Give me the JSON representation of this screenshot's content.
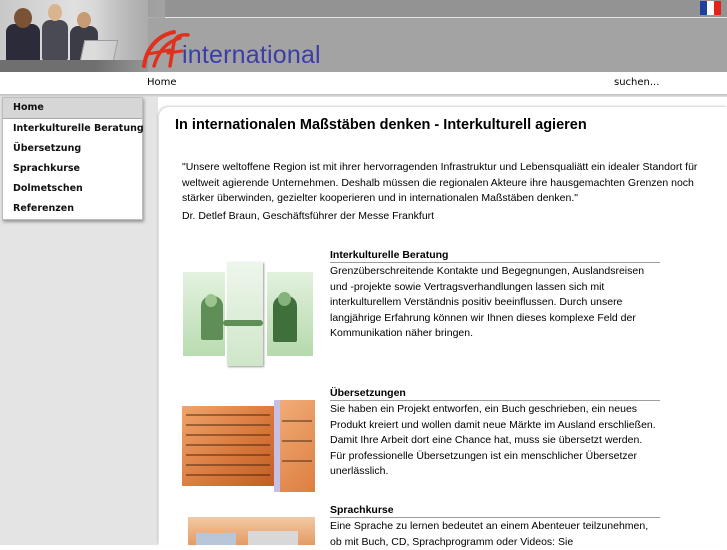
{
  "header": {
    "logo_text": "international",
    "logo_mark_text": "AF",
    "flag": "french-flag",
    "colors": {
      "header_bg": "#a3a3a3",
      "logo_text": "#3b3da8",
      "logo_mark": "#e0301e"
    }
  },
  "navbar": {
    "home_label": "Home",
    "search_label": "suchen..."
  },
  "sidebar": {
    "items": [
      {
        "label": "Home",
        "active": true
      },
      {
        "label": "Interkulturelle Beratung",
        "active": false
      },
      {
        "label": "Übersetzung",
        "active": false
      },
      {
        "label": "Sprachkurse",
        "active": false
      },
      {
        "label": "Dolmetschen",
        "active": false
      },
      {
        "label": "Referenzen",
        "active": false
      }
    ]
  },
  "main": {
    "title": "In internationalen Maßstäben denken - Interkulturell agieren",
    "quote": "\"Unsere weltoffene Region ist mit ihrer hervorragenden Infrastruktur und Lebensqualiätt ein idealer Standort für weltweit agierende Unternehmen. Deshalb müssen die regionalen Akteure ihre hausgemachten Grenzen noch stärker überwinden, gezielter kooperieren und in internationalen Maßstäben denken.\"",
    "author": "Dr. Detlef Braun, Geschäftsführer der Messe Frankfurt",
    "sections": [
      {
        "title": "Interkulturelle Beratung",
        "text": "Grenzüberschreitende Kontakte und Begegnungen, Auslandsreisen und -projekte sowie Vertragsverhandlungen lassen sich mit interkulturellem Verständnis positiv beeinflussen. Durch unsere langjährige Erfahrung können wir Ihnen dieses komplexe Feld der Kommunikation näher bringen.",
        "image": "handshake-image"
      },
      {
        "title": "Übersetzungen",
        "text": "Sie haben ein Projekt entworfen, ein Buch geschrieben, ein neues Produkt kreiert und wollen damit neue Märkte im Ausland erschließen. Damit Ihre Arbeit dort eine Chance hat, muss sie übersetzt werden. Für professionelle Übersetzungen ist ein menschlicher Übersetzer unerlässlich.",
        "image": "document-text-image"
      },
      {
        "title": "Sprachkurse",
        "text": "Eine Sprache zu lernen bedeutet an einem Abenteuer teilzunehmen, ob mit Buch, CD, Sprachprogramm oder Videos: Sie",
        "image": "language-course-image"
      }
    ]
  }
}
